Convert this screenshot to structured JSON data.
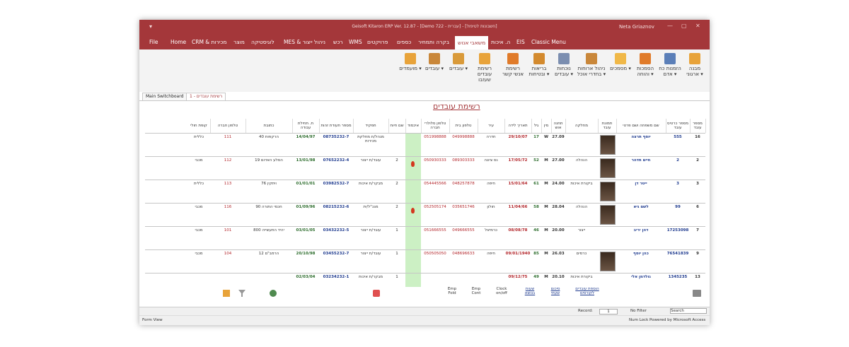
{
  "titlebar": {
    "title": "Geisoft Kitaron ERP Ver. 12.87 - [Demo עברית - 722] - [חשבונות לטיפול]",
    "user": "Neta Griaznov",
    "quick_access": "▾",
    "minimize": "—",
    "restore": "▢",
    "close": "✕"
  },
  "menu": [
    "File",
    "Home",
    "CRM & מכירות",
    "מוצר",
    "לוגיסטיקה",
    "MES & ניהול ייצור",
    "רכש",
    "WMS",
    "פרויקטים",
    "כספים",
    "בקרה ותמחיר",
    "משאבי אנוש",
    "ה. איכות",
    "EIS",
    "Classic Menu"
  ],
  "menu_active": "משאבי אנוש",
  "ribbon": {
    "buttons": [
      {
        "label": "מבנה ארגוני ▾",
        "color": "#e8a33a"
      },
      {
        "label": "הזמנות כח אדם ▾",
        "color": "#5b7fb8"
      },
      {
        "label": "הסמכות והוחה ▾",
        "color": "#e07b2a"
      },
      {
        "label": "מסמכים ▾",
        "color": "#f0b848"
      },
      {
        "label": "ניהול ארוחות בחדרי אוכל ▾",
        "color": "#c9873a"
      },
      {
        "label": "נוכחות עובדים ▾",
        "color": "#7b8eb0"
      },
      {
        "label": "בריאות ובטיחות ▾",
        "color": "#d38a2e"
      },
      {
        "label": "רשימת אנשי קשר",
        "color": "#e07b2a"
      },
      {
        "label": "רשימת עובדים שעזבו",
        "color": "#e8a33a"
      },
      {
        "label": "עובדים ▾",
        "color": "#d99a3a"
      },
      {
        "label": "עובדים ▾",
        "color": "#c9873a"
      },
      {
        "label": "מועמדים ▾",
        "color": "#e8a33a"
      }
    ],
    "group_label": "משאבי אנוש"
  },
  "tabs": [
    "Main Switchboard",
    "רשימת עובדים - 1"
  ],
  "form_title": "רשימת עובדים",
  "columns": [
    "מספר עובד",
    "מספר כרטיס עובד",
    "שם משפחה ושם פרטי",
    "תמונת עובד",
    "מחלקה",
    "תחנה אוש",
    "מין",
    "גיל",
    "תאריך לידה",
    "עיר",
    "טלפון בית",
    "טלפון סלולרי חברה",
    "איכמוד",
    "שם חיוח",
    "תפקיד",
    "מספר תעודת זהות",
    "ת. תחילת עבודה",
    "כתובת",
    "טלפון חברה",
    "קופת חולי"
  ],
  "rows": [
    {
      "num": "16",
      "card": "555",
      "name": "יוסף תרצה",
      "dept": "",
      "hours": "27.09",
      "sex": "W",
      "age": "17",
      "birth": "29/10/07",
      "city": "חדרה",
      "home": "049998888",
      "cell": "051998888",
      "flame": false,
      "shift": "",
      "role": "מנהל/ת מחלקת מכירות",
      "id": "08735232-7",
      "start": "14/04/97",
      "addr": "הרקפות 40",
      "cphone": "111",
      "fund": "כללית",
      "photo": true
    },
    {
      "num": "2",
      "card": "2",
      "name": "חיים תדהר",
      "dept": "הנהלה",
      "hours": "27.00",
      "sex": "M",
      "age": "52",
      "birth": "17/05/72",
      "city": "נס ציונה",
      "home": "089303333",
      "cell": "050930333",
      "flame": true,
      "shift": "2",
      "role": "עובד/ת ייצור",
      "id": "07652232-4",
      "start": "13/01/98",
      "addr": "הסלע האדום 19",
      "cphone": "112",
      "fund": "מכבי",
      "photo": true
    },
    {
      "num": "3",
      "card": "3",
      "name": "ייטר דן",
      "dept": "ביקורת איכות",
      "hours": "24.00",
      "sex": "M",
      "age": "61",
      "birth": "15/01/64",
      "city": "חיפה",
      "home": "048257878",
      "cell": "054445566",
      "flame": false,
      "shift": "2",
      "role": "מבקר/ת איכות",
      "id": "03982532-7",
      "start": "01/01/01",
      "addr": "ויתקין 76",
      "cphone": "113",
      "fund": "כללית",
      "photo": true
    },
    {
      "num": "6",
      "card": "99",
      "name": "לשם גיא",
      "dept": "הנהלה",
      "hours": "28.04",
      "sex": "M",
      "age": "58",
      "birth": "11/04/66",
      "city": "חולון",
      "home": "035651746",
      "cell": "052505174",
      "flame": true,
      "shift": "2",
      "role": "מנכ\"ל/ית",
      "id": "08215232-6",
      "start": "01/09/96",
      "addr": "חכמי התורה 90",
      "cphone": "116",
      "fund": "מכבי",
      "photo": true
    },
    {
      "num": "7",
      "card": "17253098",
      "name": "דהן יריב",
      "dept": "ייצור",
      "hours": "20.00",
      "sex": "M",
      "age": "46",
      "birth": "08/08/78",
      "city": "כרמיאל",
      "home": "049666555",
      "cell": "051666555",
      "flame": false,
      "shift": "1",
      "role": "עובד/ת ייצור",
      "id": "03432232-5",
      "start": "03/01/05",
      "addr": "יהיד התעשייה 800",
      "cphone": "101",
      "fund": "מכבי",
      "photo": false
    },
    {
      "num": "9",
      "card": "76541839",
      "name": "כהן יוסף",
      "dept": "כרמים",
      "hours": "26.03",
      "sex": "M",
      "age": "85",
      "birth": "09/01/1940",
      "city": "חיפה",
      "home": "048696633",
      "cell": "050505050",
      "flame": false,
      "shift": "1",
      "role": "עובד/ת ייצור",
      "id": "03455232-7",
      "start": "20/10/98",
      "addr": "הרמב\"ם 12",
      "cphone": "104",
      "fund": "מכבי",
      "photo": true
    },
    {
      "num": "13",
      "card": "1345235",
      "name": "גולדמן אלי",
      "dept": "ביקורת איכות",
      "hours": "20.10",
      "sex": "M",
      "age": "49",
      "birth": "09/12/75",
      "city": "",
      "home": "",
      "cell": "",
      "flame": false,
      "shift": "1",
      "role": "מבקר/ת איכות",
      "id": "03234232-1",
      "start": "02/03/04",
      "addr": "",
      "cphone": "",
      "fund": "",
      "photo": false
    }
  ],
  "bottom_links": [
    {
      "label": "הוספת עובדים לקורסים"
    },
    {
      "label": "סיכום שעתי"
    },
    {
      "label": "שעות בנושא"
    },
    {
      "label": "Clock on/off"
    },
    {
      "label": "Emp Cont"
    },
    {
      "label": "Emp Fold"
    }
  ],
  "nav": {
    "record_label": "Record:",
    "record_value": "1",
    "filter": "No Filter",
    "search": "Search"
  },
  "status": {
    "left": "Form View",
    "right": "Num Lock    Powered by Microsoft Access"
  },
  "colors": {
    "accent": "#a4373a",
    "green_col": "#ccf0c4",
    "blue_text": "#1f3b8f",
    "red_text": "#b3262b"
  }
}
